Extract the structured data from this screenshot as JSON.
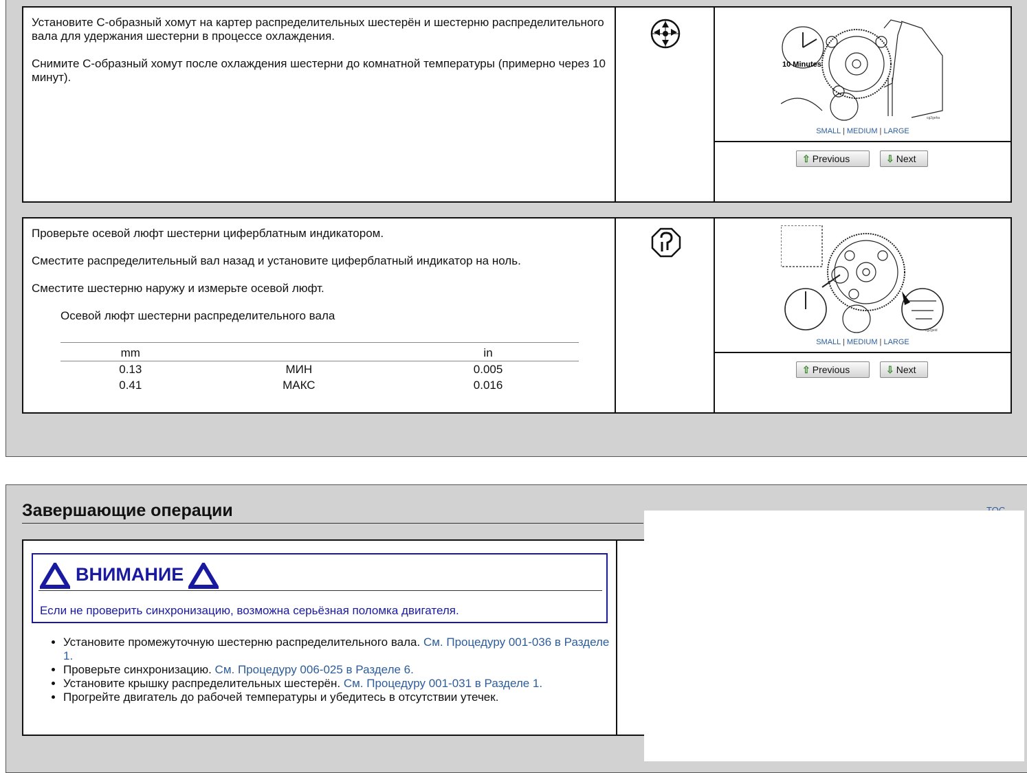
{
  "steps": [
    {
      "paragraphs": [
        "Установите С-образный хомут на картер распределительных шестерён и шестерню распределительного вала для удержания шестерни в процессе охлаждения.",
        "Снимите С-образный хомут после охлаждения шестерни до комнатной температуры (примерно через 10 минут)."
      ],
      "icon": "parts-wheel-icon",
      "image_label": "10 Minutes",
      "image_code": "cg2geha",
      "sizes": {
        "small": "SMALL",
        "medium": "MEDIUM",
        "large": "LARGE",
        "sep": "|"
      },
      "prev_label": "Previous",
      "next_label": "Next"
    },
    {
      "paragraphs": [
        "Проверьте осевой люфт шестерни циферблатным индикатором.",
        "Сместите распределительный вал назад и установите циферблатный индикатор на ноль.",
        "Сместите шестерню наружу и измерьте осевой люфт."
      ],
      "spec_title": "Осевой люфт шестерни распределительного вала",
      "spec_headers": [
        "mm",
        "",
        "in"
      ],
      "spec_rows": [
        [
          "0.13",
          "МИН",
          "0.005"
        ],
        [
          "0.41",
          "МАКС",
          "0.016"
        ]
      ],
      "icon": "inspect-icon",
      "image_code": "cg2geid",
      "sizes": {
        "small": "SMALL",
        "medium": "MEDIUM",
        "large": "LARGE",
        "sep": "|"
      },
      "prev_label": "Previous",
      "next_label": "Next"
    }
  ],
  "finishing": {
    "title": "Завершающие операции",
    "toc": "TOC",
    "warning_label": "ВНИМАНИЕ",
    "warning_text": "Если не проверить синхронизацию, возможна серьёзная поломка двигателя.",
    "items": [
      {
        "text": "Установите промежуточную шестерню распределительного вала. ",
        "link": "См. Процедуру 001-036 в Разделе 1."
      },
      {
        "text": "Проверьте синхронизацию. ",
        "link": "См. Процедуру 006-025 в Разделе 6."
      },
      {
        "text": "Установите крышку распределительных шестерён. ",
        "link": "См. Процедуру 001-031 в Разделе 1."
      },
      {
        "text": "Прогрейте двигатель до рабочей температуры и убедитесь в отсутствии утечек.",
        "link": ""
      }
    ]
  },
  "colors": {
    "warning": "#1a1aa0",
    "link": "#2d5d9a",
    "panel": "#d2d2d2"
  }
}
